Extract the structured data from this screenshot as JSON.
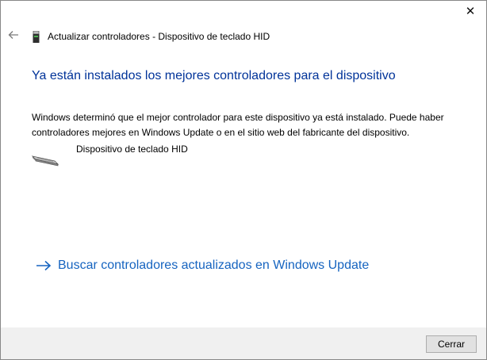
{
  "window": {
    "close_glyph": "✕"
  },
  "header": {
    "title": "Actualizar controladores - Dispositivo de teclado HID",
    "back_icon": "back-arrow-icon",
    "device_icon": "usb-device-icon"
  },
  "main": {
    "heading": "Ya están instalados los mejores controladores para el dispositivo",
    "description": "Windows determinó que el mejor controlador para este dispositivo ya está instalado. Puede haber controladores mejores en Windows Update o en el sitio web del fabricante del dispositivo.",
    "device": {
      "name": "Dispositivo de teclado HID",
      "icon": "keyboard-icon"
    },
    "link": {
      "label": "Buscar controladores actualizados en Windows Update",
      "icon": "arrow-right-icon"
    }
  },
  "footer": {
    "close_label": "Cerrar"
  },
  "colors": {
    "heading": "#003399",
    "link": "#1664c0",
    "footer_bg": "#f0f0f0"
  }
}
